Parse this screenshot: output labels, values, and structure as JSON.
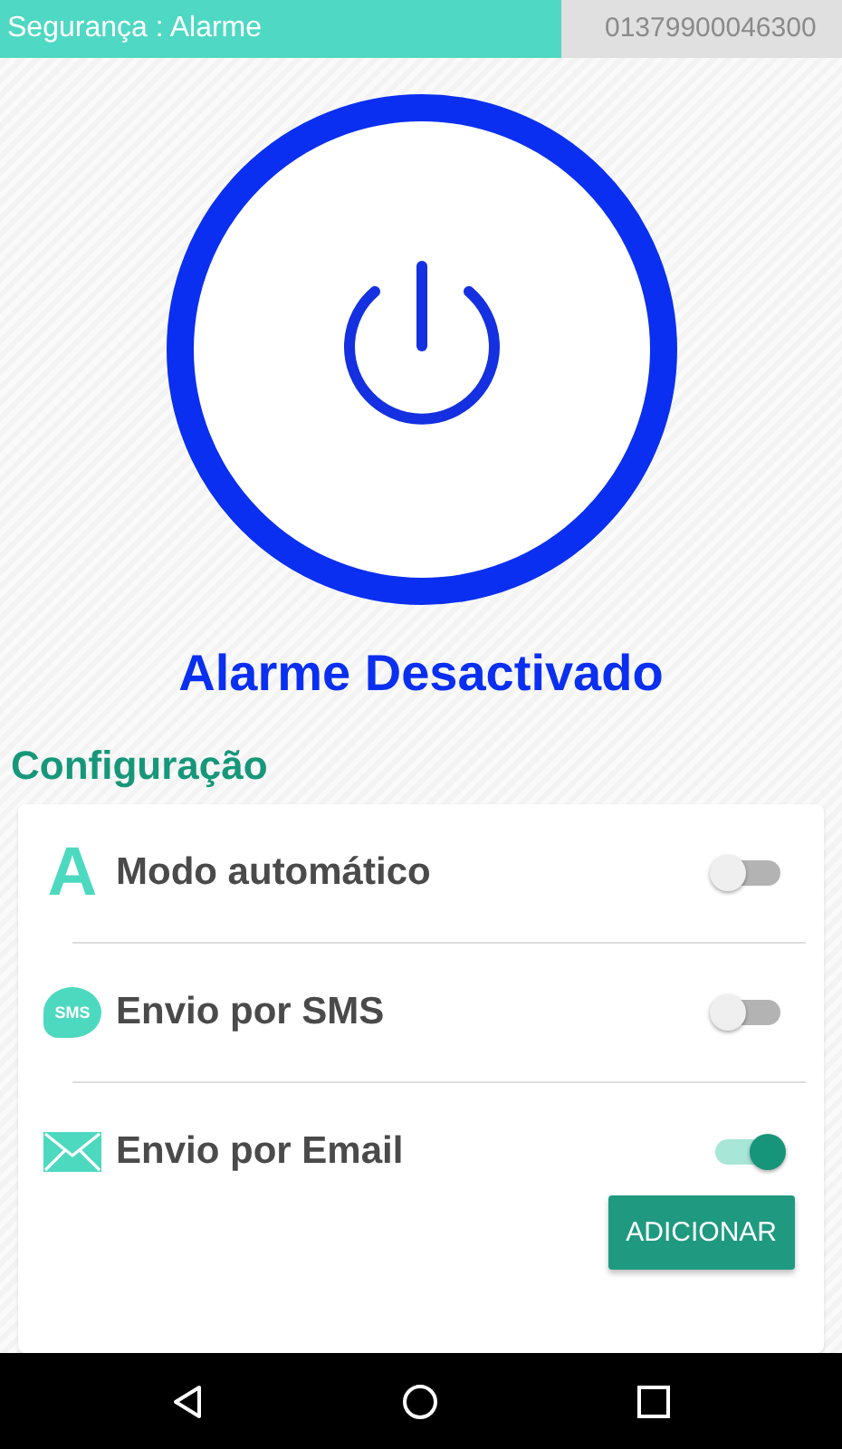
{
  "header": {
    "title": "Segurança : Alarme",
    "device_id": "01379900046300"
  },
  "alarm": {
    "on": false,
    "status": "Alarme Desactivado"
  },
  "config": {
    "heading": "Configuração",
    "options": [
      {
        "kind": "letter",
        "icon_text": "A",
        "label": "Modo automático",
        "on": false
      },
      {
        "kind": "sms",
        "icon_text": "SMS",
        "label": "Envio por SMS",
        "on": false
      },
      {
        "kind": "mail",
        "label": "Envio por Email",
        "on": true
      }
    ],
    "button": "ADICIONAR"
  }
}
